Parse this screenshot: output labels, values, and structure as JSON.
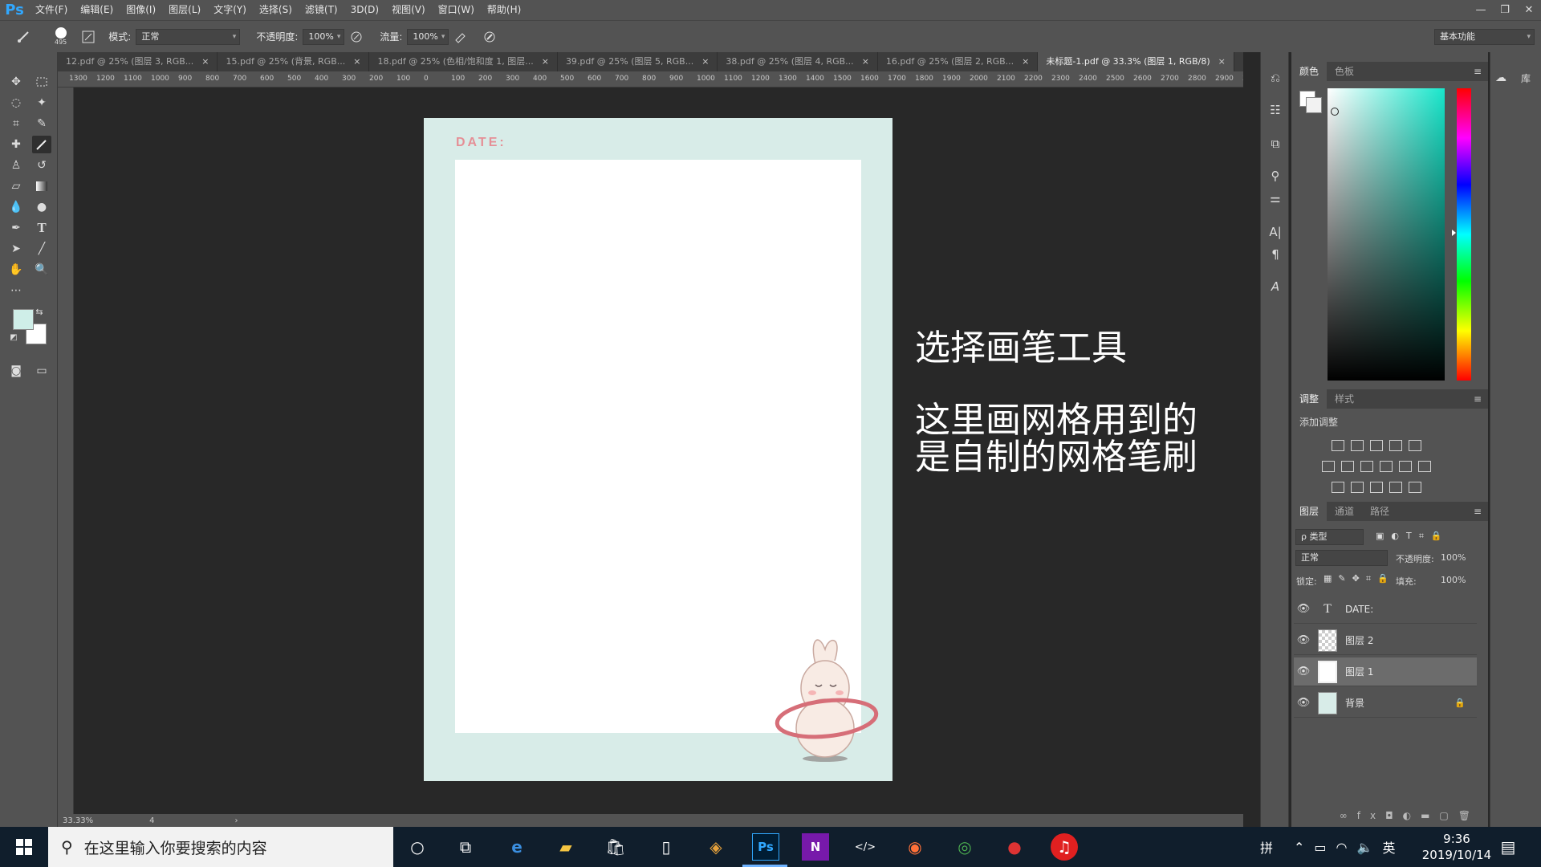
{
  "app": {
    "logo": "Ps",
    "menu": [
      "文件(F)",
      "编辑(E)",
      "图像(I)",
      "图层(L)",
      "文字(Y)",
      "选择(S)",
      "滤镜(T)",
      "3D(D)",
      "视图(V)",
      "窗口(W)",
      "帮助(H)"
    ],
    "window_controls": [
      "—",
      "❐",
      "✕"
    ]
  },
  "options_bar": {
    "brush_size": "495",
    "mode_label": "模式:",
    "mode_value": "正常",
    "opacity_label": "不透明度:",
    "opacity_value": "100%",
    "flow_label": "流量:",
    "flow_value": "100%",
    "workspace": "基本功能"
  },
  "tabs": [
    {
      "label": "12.pdf @ 25% (图层 3, RGB...",
      "active": false
    },
    {
      "label": "15.pdf @ 25% (背景, RGB...",
      "active": false
    },
    {
      "label": "18.pdf @ 25% (色相/饱和度 1, 图层...",
      "active": false
    },
    {
      "label": "39.pdf @ 25% (图层 5, RGB...",
      "active": false
    },
    {
      "label": "38.pdf @ 25% (图层 4, RGB...",
      "active": false
    },
    {
      "label": "16.pdf @ 25% (图层 2, RGB...",
      "active": false
    },
    {
      "label": "未标题-1.pdf @ 33.3% (图层 1, RGB/8)",
      "active": true
    }
  ],
  "ruler_labels": [
    "1300",
    "1200",
    "1100",
    "1000",
    "900",
    "800",
    "700",
    "600",
    "500",
    "400",
    "300",
    "200",
    "100",
    "0",
    "100",
    "200",
    "300",
    "400",
    "500",
    "600",
    "700",
    "800",
    "900",
    "1000",
    "1100",
    "1200",
    "1300",
    "1400",
    "1500",
    "1600",
    "1700",
    "1800",
    "1900",
    "2000",
    "2100",
    "2200",
    "2300",
    "2400",
    "2500",
    "2600",
    "2700",
    "2800",
    "2900",
    "300"
  ],
  "document": {
    "date_label": "DATE:"
  },
  "captions": {
    "line1": "选择画笔工具",
    "line2": "这里画网格用到的",
    "line3": "是自制的网格笔刷"
  },
  "status": {
    "zoom": "33.33%",
    "info": "4"
  },
  "panels": {
    "color_tabs": [
      "颜色",
      "色板"
    ],
    "adjust_tabs": [
      "调整",
      "样式"
    ],
    "add_adjustment": "添加调整",
    "layers_tabs": [
      "图层",
      "通道",
      "路径"
    ],
    "filter_kind": "ρ 类型",
    "blend_mode": "正常",
    "opacity_label": "不透明度:",
    "opacity_value": "100%",
    "lock_label": "锁定:",
    "fill_label": "填充:",
    "fill_value": "100%",
    "layers": [
      {
        "name": "DATE:",
        "type": "text"
      },
      {
        "name": "图层 2",
        "type": "transparent"
      },
      {
        "name": "图层 1",
        "type": "white",
        "selected": true
      },
      {
        "name": "背景",
        "type": "background",
        "locked": true
      }
    ],
    "far_strip_label": "库"
  },
  "taskbar": {
    "search_placeholder": "在这里输入你要搜索的内容",
    "time": "9:36",
    "date": "2019/10/14",
    "ime": "英",
    "ime2": "拼"
  },
  "colors": {
    "accent_ps": "#31a8ff",
    "doc_bg": "#d8ece8",
    "date_color": "#e58f96",
    "foreground_swatch": "#cfeee8"
  }
}
